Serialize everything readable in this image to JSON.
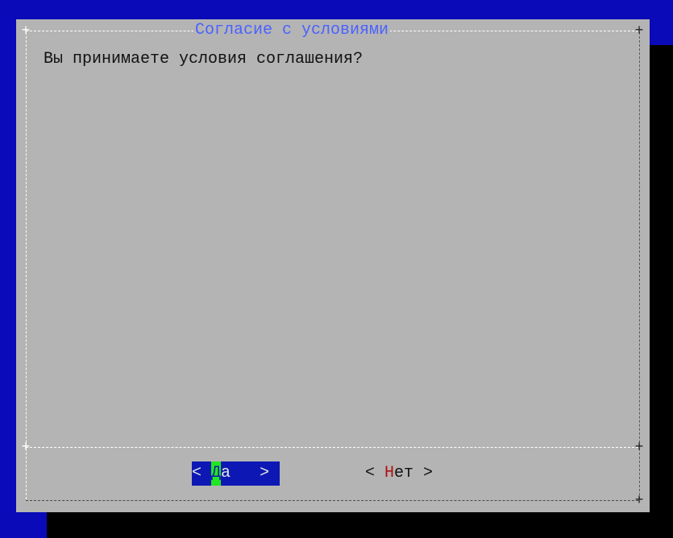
{
  "dialog": {
    "title": "Согласие с условиями",
    "question": "Вы принимаете условия соглашения?"
  },
  "buttons": {
    "yes": {
      "open": "< ",
      "hotkey": "Д",
      "rest": "а",
      "close": ">",
      "gap": "   "
    },
    "no": {
      "open": "< ",
      "hotkey": "Н",
      "rest": "ет",
      "close": " >"
    }
  },
  "colors": {
    "background": "#0a0ab8",
    "dialog": "#b4b4b4",
    "title": "#4b62ff",
    "selected_button": "#0d18b4",
    "hotkey_highlight": "#22e622",
    "hotkey_text": "#b01010"
  }
}
